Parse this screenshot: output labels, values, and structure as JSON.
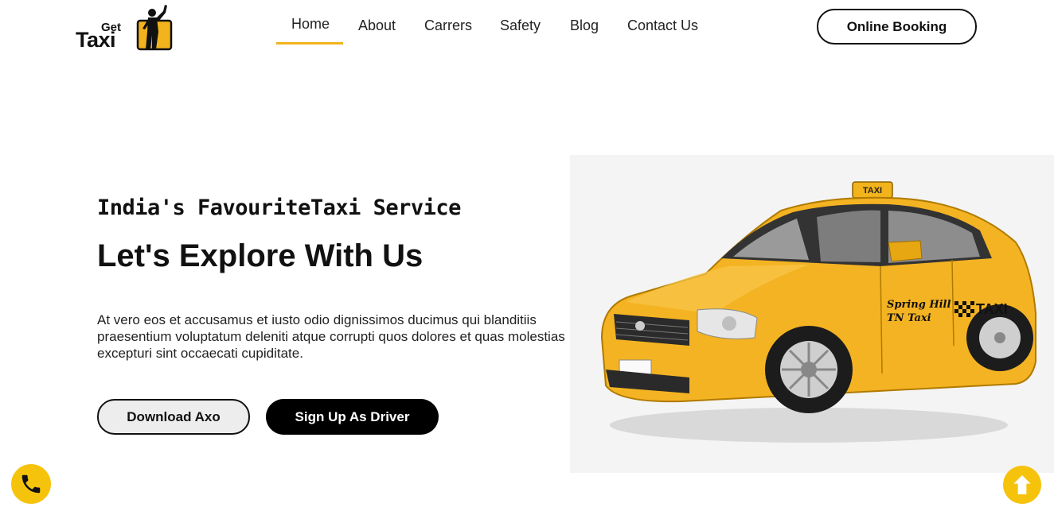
{
  "brand": {
    "logo_word_small": "Get",
    "logo_word_large": "Taxi",
    "accent_color": "#f2b31c"
  },
  "nav": {
    "items": [
      {
        "label": "Home",
        "active": true
      },
      {
        "label": "About",
        "active": false
      },
      {
        "label": "Carrers",
        "active": false
      },
      {
        "label": "Safety",
        "active": false
      },
      {
        "label": "Blog",
        "active": false
      },
      {
        "label": "Contact Us",
        "active": false
      }
    ],
    "cta_label": "Online Booking"
  },
  "hero": {
    "subtitle": "India's FavouriteTaxi Service",
    "title": "Let's Explore With Us",
    "description": "At vero eos et accusamus et iusto odio dignissimos ducimus qui blanditiis praesentium voluptatum deleniti atque corrupti quos dolores et quas molestias excepturi sint occaecati cupiditate.",
    "primary_button": "Download Axo",
    "secondary_button": "Sign Up As Driver",
    "image": {
      "roof_sign": "TAXI",
      "door_text_line1": "Spring Hill",
      "door_text_line2": "TN Taxi",
      "door_badge": "TAXI"
    }
  },
  "floating": {
    "call_icon": "phone-icon",
    "top_icon": "arrow-up-icon",
    "color": "#f6c30c"
  }
}
